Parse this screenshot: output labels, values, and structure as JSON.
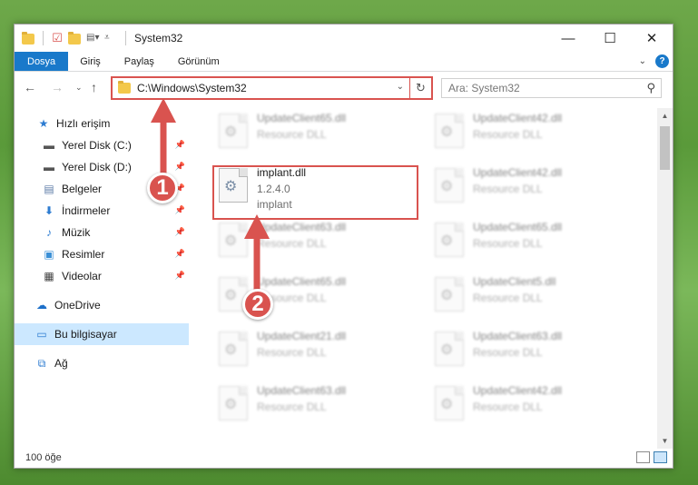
{
  "window": {
    "title": "System32",
    "controls": {
      "minimize": "—",
      "maximize": "☐",
      "close": "✕"
    }
  },
  "ribbon": {
    "tabs": [
      "Dosya",
      "Giriş",
      "Paylaş",
      "Görünüm"
    ],
    "help": "?"
  },
  "address": {
    "path": "C:\\Windows\\System32",
    "search_placeholder": "Ara: System32"
  },
  "sidebar": {
    "items": [
      {
        "label": "Hızlı erişim",
        "icon": "star-icon",
        "pinned": false
      },
      {
        "label": "Yerel Disk (C:)",
        "icon": "drive-icon",
        "pinned": true
      },
      {
        "label": "Yerel Disk (D:)",
        "icon": "drive-icon",
        "pinned": true
      },
      {
        "label": "Belgeler",
        "icon": "documents-icon",
        "pinned": true
      },
      {
        "label": "İndirmeler",
        "icon": "download-icon",
        "pinned": true
      },
      {
        "label": "Müzik",
        "icon": "music-icon",
        "pinned": true
      },
      {
        "label": "Resimler",
        "icon": "pictures-icon",
        "pinned": true
      },
      {
        "label": "Videolar",
        "icon": "video-icon",
        "pinned": true
      },
      {
        "label": "OneDrive",
        "icon": "cloud-icon",
        "pinned": false
      },
      {
        "label": "Bu bilgisayar",
        "icon": "computer-icon",
        "pinned": false,
        "selected": true
      },
      {
        "label": "Ağ",
        "icon": "network-icon",
        "pinned": false
      }
    ]
  },
  "files": [
    {
      "name": "UpdateClient65.dll",
      "type": "Resource DLL"
    },
    {
      "name": "UpdateClient42.dll",
      "type": "Resource DLL"
    },
    {
      "name": "implant.dll",
      "type": "1.2.4.0",
      "company": "implant",
      "highlighted": true
    },
    {
      "name": "UpdateClient42.dll",
      "type": "Resource DLL"
    },
    {
      "name": "UpdateClient63.dll",
      "type": "Resource DLL"
    },
    {
      "name": "UpdateClient65.dll",
      "type": "Resource DLL"
    },
    {
      "name": "UpdateClient65.dll",
      "type": "Resource DLL"
    },
    {
      "name": "UpdateClient5.dll",
      "type": "Resource DLL"
    },
    {
      "name": "UpdateClient21.dll",
      "type": "Resource DLL"
    },
    {
      "name": "UpdateClient63.dll",
      "type": "Resource DLL"
    },
    {
      "name": "UpdateClient63.dll",
      "type": "Resource DLL"
    },
    {
      "name": "UpdateClient42.dll",
      "type": "Resource DLL"
    }
  ],
  "status": {
    "count": "100 öğe"
  },
  "callouts": [
    "1",
    "2"
  ],
  "colors": {
    "accent": "#1979ca",
    "annotation": "#d9534f",
    "selected": "#cce8ff"
  }
}
